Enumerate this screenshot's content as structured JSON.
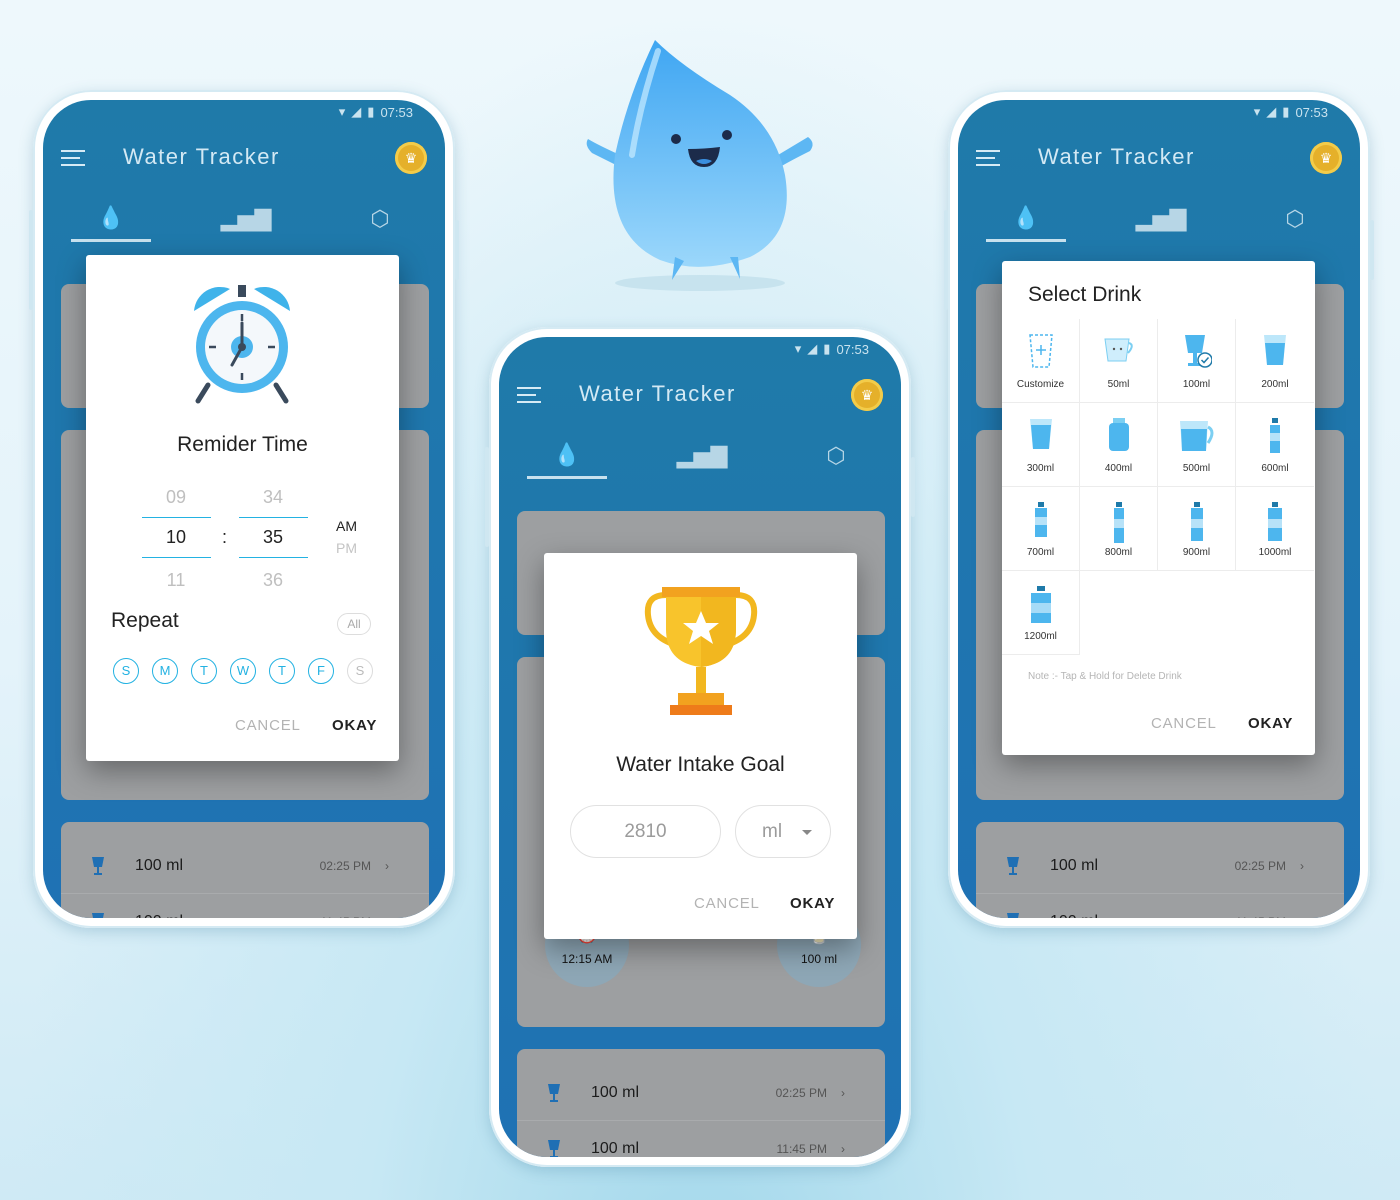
{
  "status_bar": {
    "time": "07:53"
  },
  "app": {
    "title": "Water Tracker"
  },
  "reminder_dialog": {
    "title": "Remider Time",
    "hour_prev": "09",
    "hour": "10",
    "hour_next": "11",
    "colon": ":",
    "minute_prev": "34",
    "minute": "35",
    "minute_next": "36",
    "am": "AM",
    "pm": "PM",
    "repeat_label": "Repeat",
    "all_label": "All",
    "days": [
      "S",
      "M",
      "T",
      "W",
      "T",
      "F",
      "S"
    ],
    "cancel": "CANCEL",
    "okay": "OKAY"
  },
  "goal_dialog": {
    "title": "Water Intake Goal",
    "value": "2810",
    "unit": "ml",
    "cancel": "CANCEL",
    "okay": "OKAY"
  },
  "home": {
    "next_reminder_time": "12:15 AM",
    "cup_size": "100 ml"
  },
  "drink_dialog": {
    "title": "Select Drink",
    "drinks": [
      "Customize",
      "50ml",
      "100ml",
      "200ml",
      "300ml",
      "400ml",
      "500ml",
      "600ml",
      "700ml",
      "800ml",
      "900ml",
      "1000ml",
      "1200ml"
    ],
    "note": "Note :- Tap & Hold for Delete Drink",
    "cancel": "CANCEL",
    "okay": "OKAY"
  },
  "log": [
    {
      "amount": "100 ml",
      "time": "02:25 PM"
    },
    {
      "amount": "100 ml",
      "time": "11:45 PM"
    }
  ],
  "colors": {
    "primary": "#1f7aa9",
    "accent": "#23b2e2",
    "coin": "#e5b02a"
  }
}
